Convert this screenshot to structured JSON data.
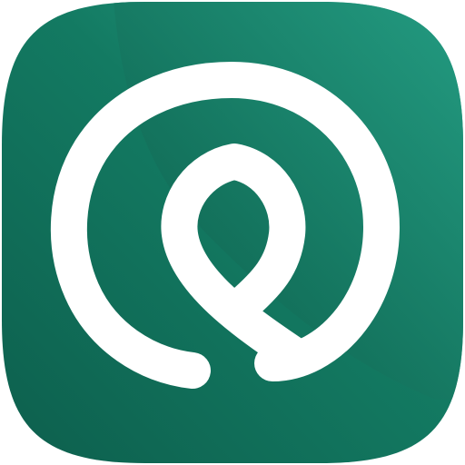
{
  "icon": {
    "semantic": "leaf-in-circle-app-icon",
    "colors": {
      "background_dark": "#0d5f4d",
      "background_mid": "#137a62",
      "background_light": "#2aa78d",
      "inner_shade": "#0b5a47",
      "glyph": "#ffffff"
    }
  }
}
